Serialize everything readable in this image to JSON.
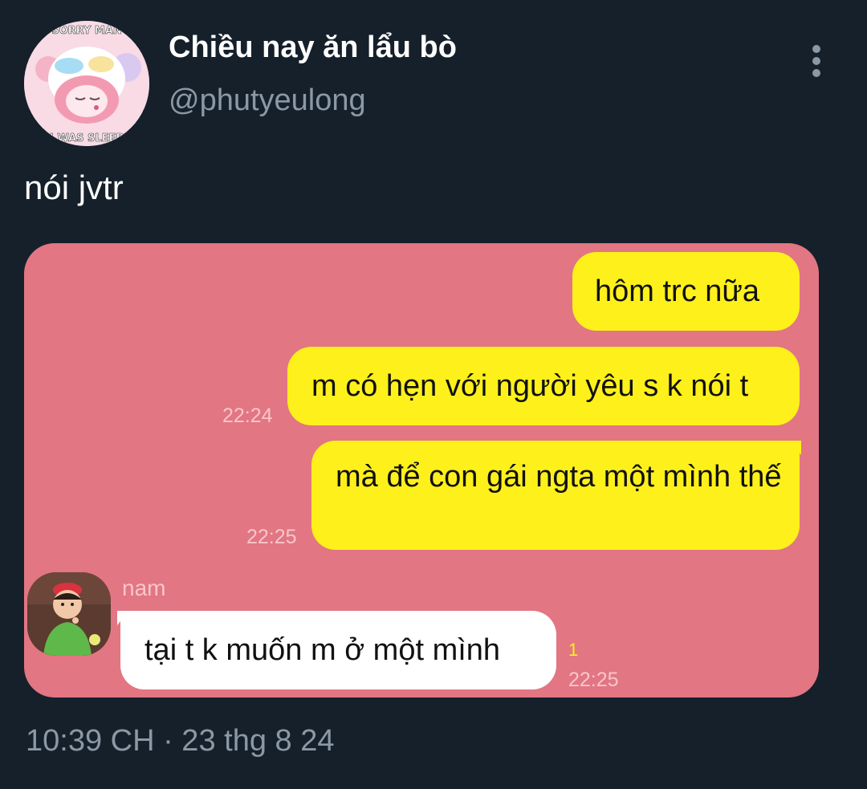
{
  "tweet": {
    "display_name": "Chiều nay ăn lẩu bò",
    "handle": "@phutyeulong",
    "text": "nói jvtr",
    "timestamp": "10:39 CH · 23 thg 8 24",
    "avatar_text_top": "SORRY MAN",
    "avatar_text_bottom": "I WAS SLEEP"
  },
  "chat": {
    "messages": [
      {
        "text": "hôm trc nữa"
      },
      {
        "text": "m có hẹn với người yêu s k nói t",
        "time": "22:24"
      },
      {
        "text": "mà để con gái ngta một mình thế",
        "time": "22:25"
      }
    ],
    "friend": {
      "name": "nam",
      "message": "tại t k muốn m ở một mình",
      "unread": "1",
      "time": "22:25"
    }
  },
  "colors": {
    "background": "#15202b",
    "chat_background": "#e27682",
    "my_bubble": "#fef01b",
    "friend_bubble": "#ffffff",
    "muted_text": "#8b98a5"
  },
  "icons": {
    "more": "vertical-ellipsis-icon"
  }
}
